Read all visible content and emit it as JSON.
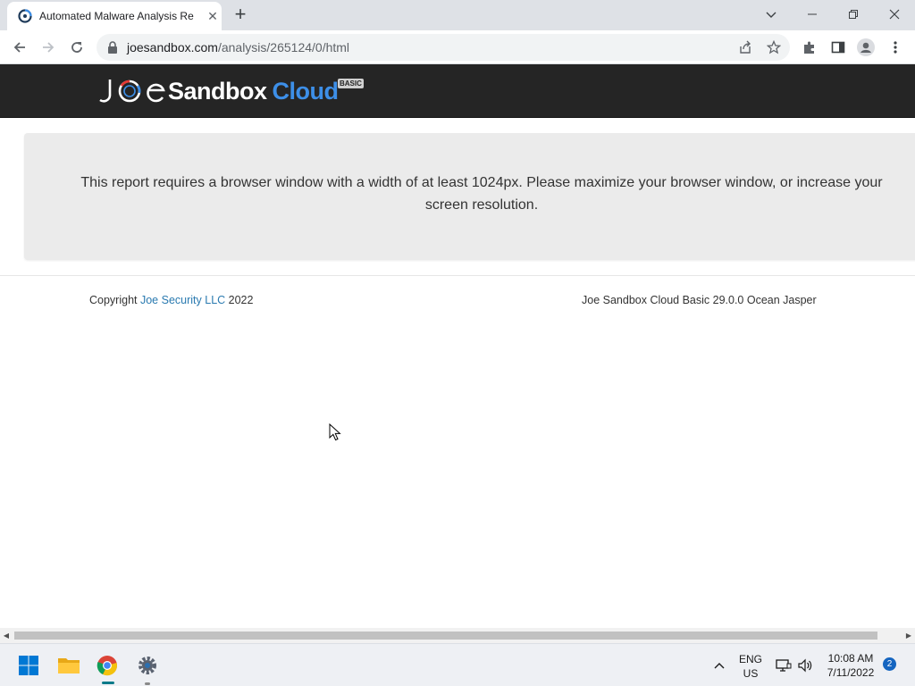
{
  "browser": {
    "tab": {
      "title": "Automated Malware Analysis Re",
      "close_symbol": "✕"
    },
    "new_tab_symbol": "+",
    "window_controls": {
      "dropdown": "⌄",
      "minimize": "—",
      "restore": "❐",
      "close": "✕"
    },
    "url": {
      "host": "joesandbox.com",
      "path": "/analysis/265124/0/html"
    }
  },
  "site": {
    "logo": {
      "joe": "JOE",
      "sandbox": "Sandbox",
      "cloud": "Cloud",
      "edition": "BASIC"
    },
    "notice": "This report requires a browser window with a width of at least 1024px. Please maximize your browser window, or increase your screen resolution.",
    "footer": {
      "copyright_prefix": "Copyright ",
      "company": "Joe Security LLC",
      "year": " 2022",
      "version": "Joe Sandbox Cloud Basic 29.0.0 Ocean Jasper"
    }
  },
  "taskbar": {
    "language": "ENG",
    "region": "US",
    "time": "10:08 AM",
    "date": "7/11/2022",
    "notification_count": "2"
  },
  "colors": {
    "header_bg": "#252525",
    "cloud_blue": "#3d8fe8",
    "link": "#2a7ab0",
    "notice_bg": "#ebebeb"
  }
}
